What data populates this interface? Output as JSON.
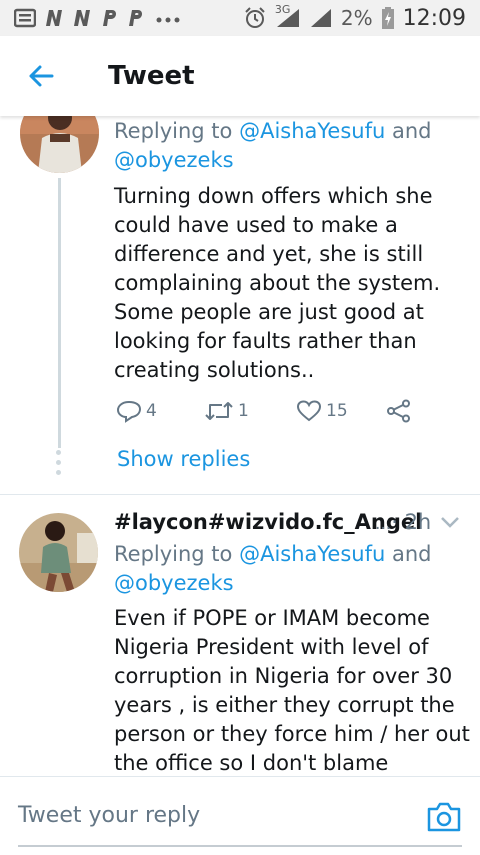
{
  "status_bar": {
    "left_icons": [
      "notification-icon",
      "n-icon",
      "n-icon",
      "p-icon",
      "p-icon",
      "more-dots-icon"
    ],
    "network": "3G",
    "battery": "2%",
    "time": "12:09"
  },
  "header": {
    "title": "Tweet"
  },
  "tweets": [
    {
      "replying_prefix": "Replying to ",
      "mention1": "@AishaYesufu",
      "and_text": " and",
      "mention2": "@obyezeks",
      "body": [
        "Turning down offers which she",
        "could have used to make a",
        "difference and yet, she is still",
        "complaining about the system.",
        "Some people are just good at",
        "looking for faults rather than",
        "creating solutions.."
      ],
      "replies": "4",
      "retweets": "1",
      "likes": "15",
      "show_replies": "Show replies"
    },
    {
      "author": "#laycon#wizvido.fc_Angel",
      "ellipsis": "...",
      "time": "· 2h",
      "replying_prefix": "Replying to ",
      "mention1": "@AishaYesufu",
      "and_text": " and",
      "mention2": "@obyezeks",
      "body": [
        "Even if POPE or IMAM become",
        "Nigeria President with level of",
        "corruption  in Nigeria for over 30",
        "years , is either they corrupt the",
        "person or they force him / her out",
        "the office so I don't blame"
      ]
    }
  ],
  "reply_bar": {
    "placeholder": "Tweet your reply"
  },
  "colors": {
    "link": "#1b95e0",
    "secondary": "#657786",
    "text": "#14171a"
  }
}
